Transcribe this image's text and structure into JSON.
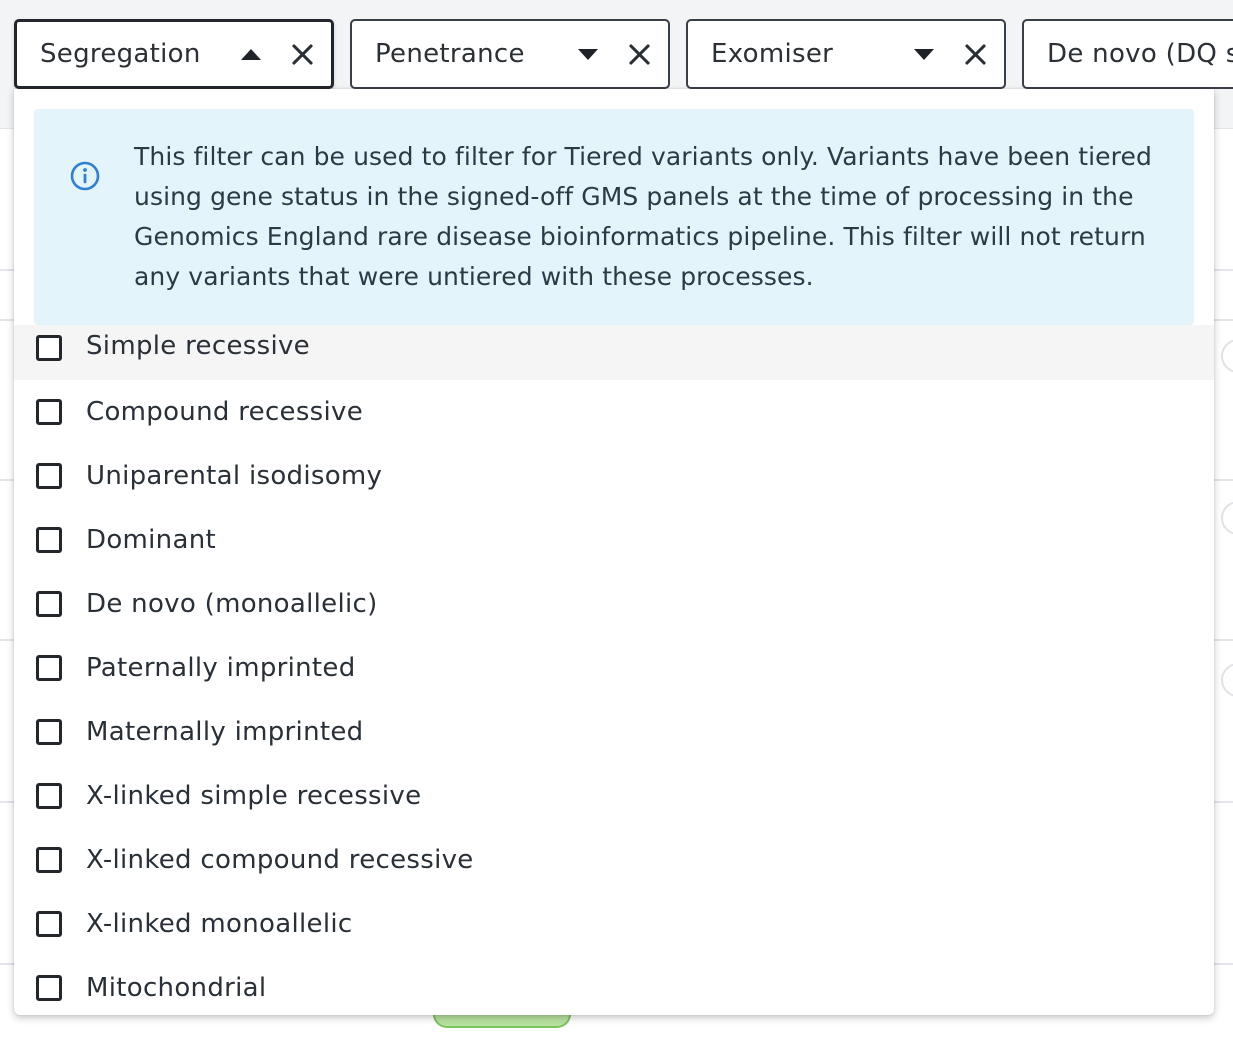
{
  "filters": [
    {
      "label": "Segregation",
      "caret": "up",
      "active": true
    },
    {
      "label": "Penetrance",
      "caret": "down",
      "active": false
    },
    {
      "label": "Exomiser",
      "caret": "down",
      "active": false
    },
    {
      "label": "De novo (DQ s",
      "caret": "down",
      "active": false
    }
  ],
  "dropdown": {
    "info_icon": "info-circle-icon",
    "info_text": "This filter can be used to filter for Tiered variants only. Variants have been tiered using gene status in the signed-off GMS panels at the time of processing in the Genomics England rare disease bioinformatics pipeline. This filter will not return any variants that were untiered with these processes.",
    "options": [
      {
        "label": "Simple recessive",
        "checked": false,
        "hovered": true
      },
      {
        "label": "Compound recessive",
        "checked": false
      },
      {
        "label": "Uniparental isodisomy",
        "checked": false
      },
      {
        "label": "Dominant",
        "checked": false
      },
      {
        "label": "De novo (monoallelic)",
        "checked": false
      },
      {
        "label": "Paternally imprinted",
        "checked": false
      },
      {
        "label": "Maternally imprinted",
        "checked": false
      },
      {
        "label": "X-linked simple recessive",
        "checked": false
      },
      {
        "label": "X-linked compound recessive",
        "checked": false
      },
      {
        "label": "X-linked monoallelic",
        "checked": false
      },
      {
        "label": "Mitochondrial",
        "checked": false
      }
    ]
  },
  "colors": {
    "info_background": "#e3f4fb",
    "info_icon": "#2f7fd6",
    "border_dark": "#23272d",
    "hover_row": "#f5f5f5"
  }
}
